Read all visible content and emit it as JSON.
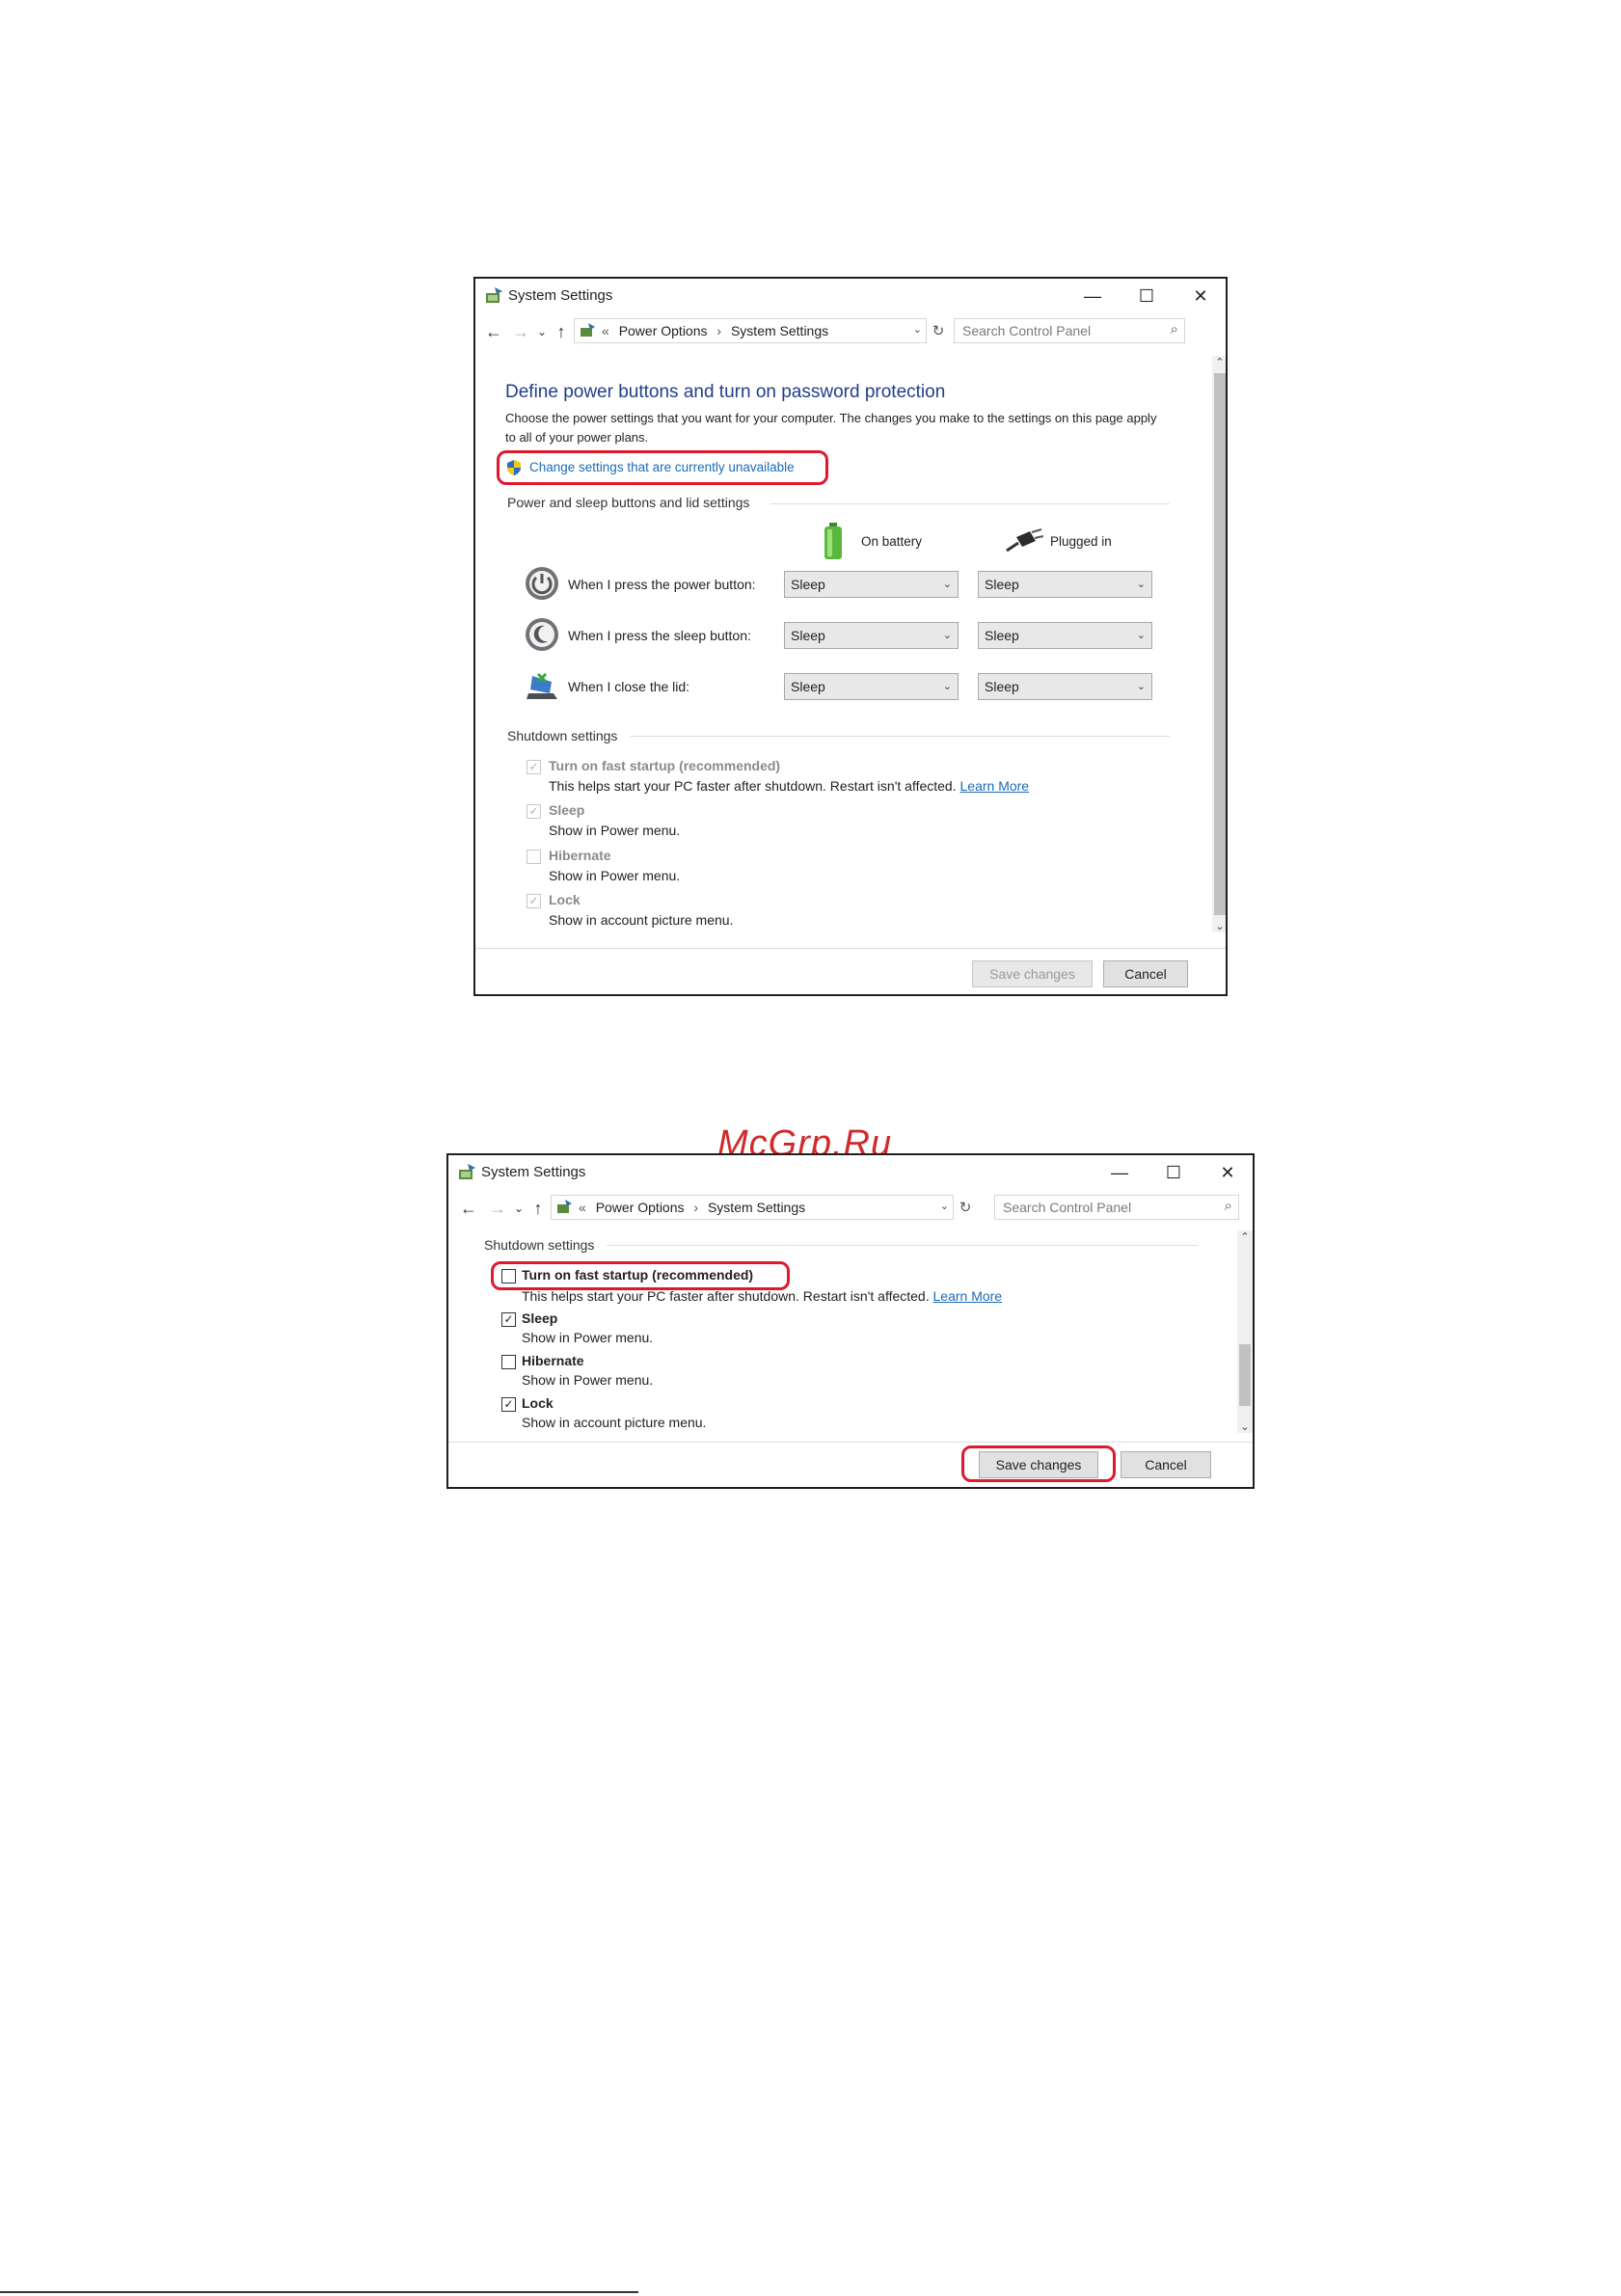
{
  "watermark": "McGrp.Ru",
  "window1": {
    "title": "System Settings",
    "controls": {
      "minimize": "—",
      "maximize": "☐",
      "close": "✕"
    },
    "breadcrumb": {
      "chevron": "«",
      "items": [
        "Power Options",
        "System Settings"
      ]
    },
    "search_placeholder": "Search Control Panel",
    "heading": "Define power buttons and turn on password protection",
    "description": "Choose the power settings that you want for your computer. The changes you make to the settings on this page apply to all of your power plans.",
    "uac_link": "Change settings that are currently unavailable",
    "section_power": "Power and sleep buttons and lid settings",
    "col_battery": "On battery",
    "col_plugged": "Plugged in",
    "rows": [
      {
        "label": "When I press the power button:",
        "battery": "Sleep",
        "plugged": "Sleep"
      },
      {
        "label": "When I press the sleep button:",
        "battery": "Sleep",
        "plugged": "Sleep"
      },
      {
        "label": "When I close the lid:",
        "battery": "Sleep",
        "plugged": "Sleep"
      }
    ],
    "section_shutdown": "Shutdown settings",
    "options": [
      {
        "label": "Turn on fast startup (recommended)",
        "checked": true,
        "desc": "This helps start your PC faster after shutdown. Restart isn't affected.",
        "link": "Learn More"
      },
      {
        "label": "Sleep",
        "checked": true,
        "desc": "Show in Power menu."
      },
      {
        "label": "Hibernate",
        "checked": false,
        "desc": "Show in Power menu."
      },
      {
        "label": "Lock",
        "checked": true,
        "desc": "Show in account picture menu."
      }
    ],
    "save_button": "Save changes",
    "cancel_button": "Cancel"
  },
  "window2": {
    "title": "System Settings",
    "controls": {
      "minimize": "—",
      "maximize": "☐",
      "close": "✕"
    },
    "breadcrumb": {
      "chevron": "«",
      "items": [
        "Power Options",
        "System Settings"
      ]
    },
    "search_placeholder": "Search Control Panel",
    "section_shutdown": "Shutdown settings",
    "options": [
      {
        "label": "Turn on fast startup (recommended)",
        "checked": false,
        "desc": "This helps start your PC faster after shutdown. Restart isn't affected.",
        "link": "Learn More"
      },
      {
        "label": "Sleep",
        "checked": true,
        "desc": "Show in Power menu."
      },
      {
        "label": "Hibernate",
        "checked": false,
        "desc": "Show in Power menu."
      },
      {
        "label": "Lock",
        "checked": true,
        "desc": "Show in account picture menu."
      }
    ],
    "save_button": "Save changes",
    "cancel_button": "Cancel"
  },
  "colors": {
    "heading": "#1f3f8a",
    "link": "#1a6bb8",
    "highlight_ring": "#e0182c",
    "watermark": "#cf2b2b"
  },
  "icons": [
    "control-panel-icon",
    "back-arrow-icon",
    "forward-arrow-icon",
    "recent-dropdown-icon",
    "up-arrow-icon",
    "refresh-icon",
    "search-icon",
    "uac-shield-icon",
    "battery-icon",
    "power-plug-icon",
    "power-button-icon",
    "sleep-button-icon",
    "laptop-lid-icon",
    "chevron-down-icon"
  ]
}
